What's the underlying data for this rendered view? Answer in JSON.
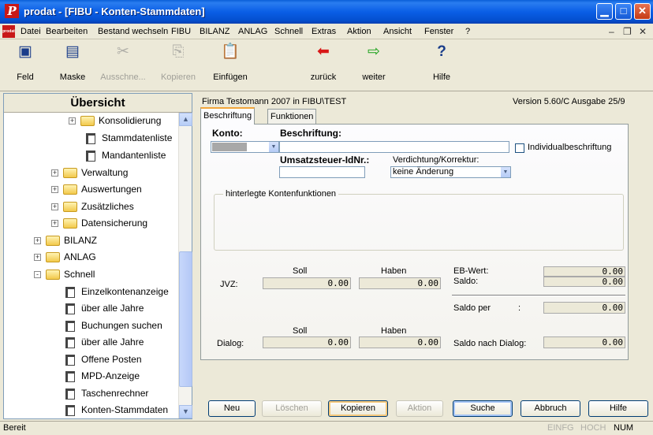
{
  "window": {
    "title": "prodat - [FIBU - Konten-Stammdaten]",
    "app_icon": "P",
    "doc_icon": "prodat"
  },
  "menu": [
    "Datei",
    "Bearbeiten",
    "Bestand wechseln",
    "FIBU",
    "BILANZ",
    "ANLAG",
    "Schnell",
    "Extras",
    "Aktion",
    "Ansicht",
    "Fenster",
    "?"
  ],
  "toolbar": {
    "feld": "Feld",
    "maske": "Maske",
    "ausschneiden": "Ausschne...",
    "kopieren": "Kopieren",
    "einfuegen": "Einfügen",
    "zurueck": "zurück",
    "weiter": "weiter",
    "hilfe": "Hilfe"
  },
  "sidebar": {
    "title": "Übersicht",
    "items": [
      {
        "label": "Konsolidierung",
        "kind": "folder",
        "expander": "+"
      },
      {
        "label": "Stammdatenliste",
        "kind": "page"
      },
      {
        "label": "Mandantenliste",
        "kind": "page"
      },
      {
        "label": "Verwaltung",
        "kind": "folder",
        "expander": "+"
      },
      {
        "label": "Auswertungen",
        "kind": "folder",
        "expander": "+"
      },
      {
        "label": "Zusätzliches",
        "kind": "folder",
        "expander": "+"
      },
      {
        "label": "Datensicherung",
        "kind": "folder",
        "expander": "+"
      },
      {
        "label": "BILANZ",
        "kind": "folder",
        "expander": "+"
      },
      {
        "label": "ANLAG",
        "kind": "folder",
        "expander": "+"
      },
      {
        "label": "Schnell",
        "kind": "folder",
        "expander": "-"
      },
      {
        "label": "Einzelkontenanzeige",
        "kind": "page"
      },
      {
        "label": "über alle Jahre",
        "kind": "page"
      },
      {
        "label": "Buchungen suchen",
        "kind": "page"
      },
      {
        "label": "über alle Jahre",
        "kind": "page"
      },
      {
        "label": "Offene Posten",
        "kind": "page"
      },
      {
        "label": "MPD-Anzeige",
        "kind": "page"
      },
      {
        "label": "Taschenrechner",
        "kind": "page"
      },
      {
        "label": "Konten-Stammdaten",
        "kind": "page"
      }
    ]
  },
  "main": {
    "firm": "Firma Testomann 2007 in FIBU\\TEST",
    "version": "Version 5.60/C Ausgabe 25/9",
    "tabs": [
      "Beschriftung",
      "Funktionen"
    ],
    "labels": {
      "konto": "Konto:",
      "beschriftung": "Beschriftung:",
      "individual": "Individualbeschriftung",
      "ust": "Umsatzsteuer-IdNr.:",
      "verdichtung": "Verdichtung/Korrektur:",
      "hinterlegte": "hinterlegte Kontenfunktionen",
      "soll": "Soll",
      "haben": "Haben",
      "jvz": "JVZ:",
      "dialog": "Dialog:",
      "eb_wert": "EB-Wert:",
      "saldo": "Saldo:",
      "saldo_per": "Saldo per",
      "saldo_per_colon": ":",
      "saldo_nach_dialog": "Saldo nach Dialog:"
    },
    "verdichtung_value": "keine Änderung",
    "values": {
      "jvz_soll": "0.00",
      "jvz_haben": "0.00",
      "eb_wert": "0.00",
      "saldo": "0.00",
      "saldo_per": "0.00",
      "dialog_soll": "0.00",
      "dialog_haben": "0.00",
      "saldo_nach_dialog": "0.00"
    },
    "buttons": {
      "neu": "Neu",
      "loeschen": "Löschen",
      "kopieren": "Kopieren",
      "aktion": "Aktion",
      "suche": "Suche",
      "abbruch": "Abbruch",
      "hilfe": "Hilfe"
    }
  },
  "status": {
    "text": "Bereit",
    "einfg": "EINFG",
    "hoch": "HOCH",
    "num": "NUM"
  },
  "colors": {
    "titlebar": "#0a5ee6",
    "app_icon": "#c81818",
    "tab_highlight": "#f2a63b"
  }
}
